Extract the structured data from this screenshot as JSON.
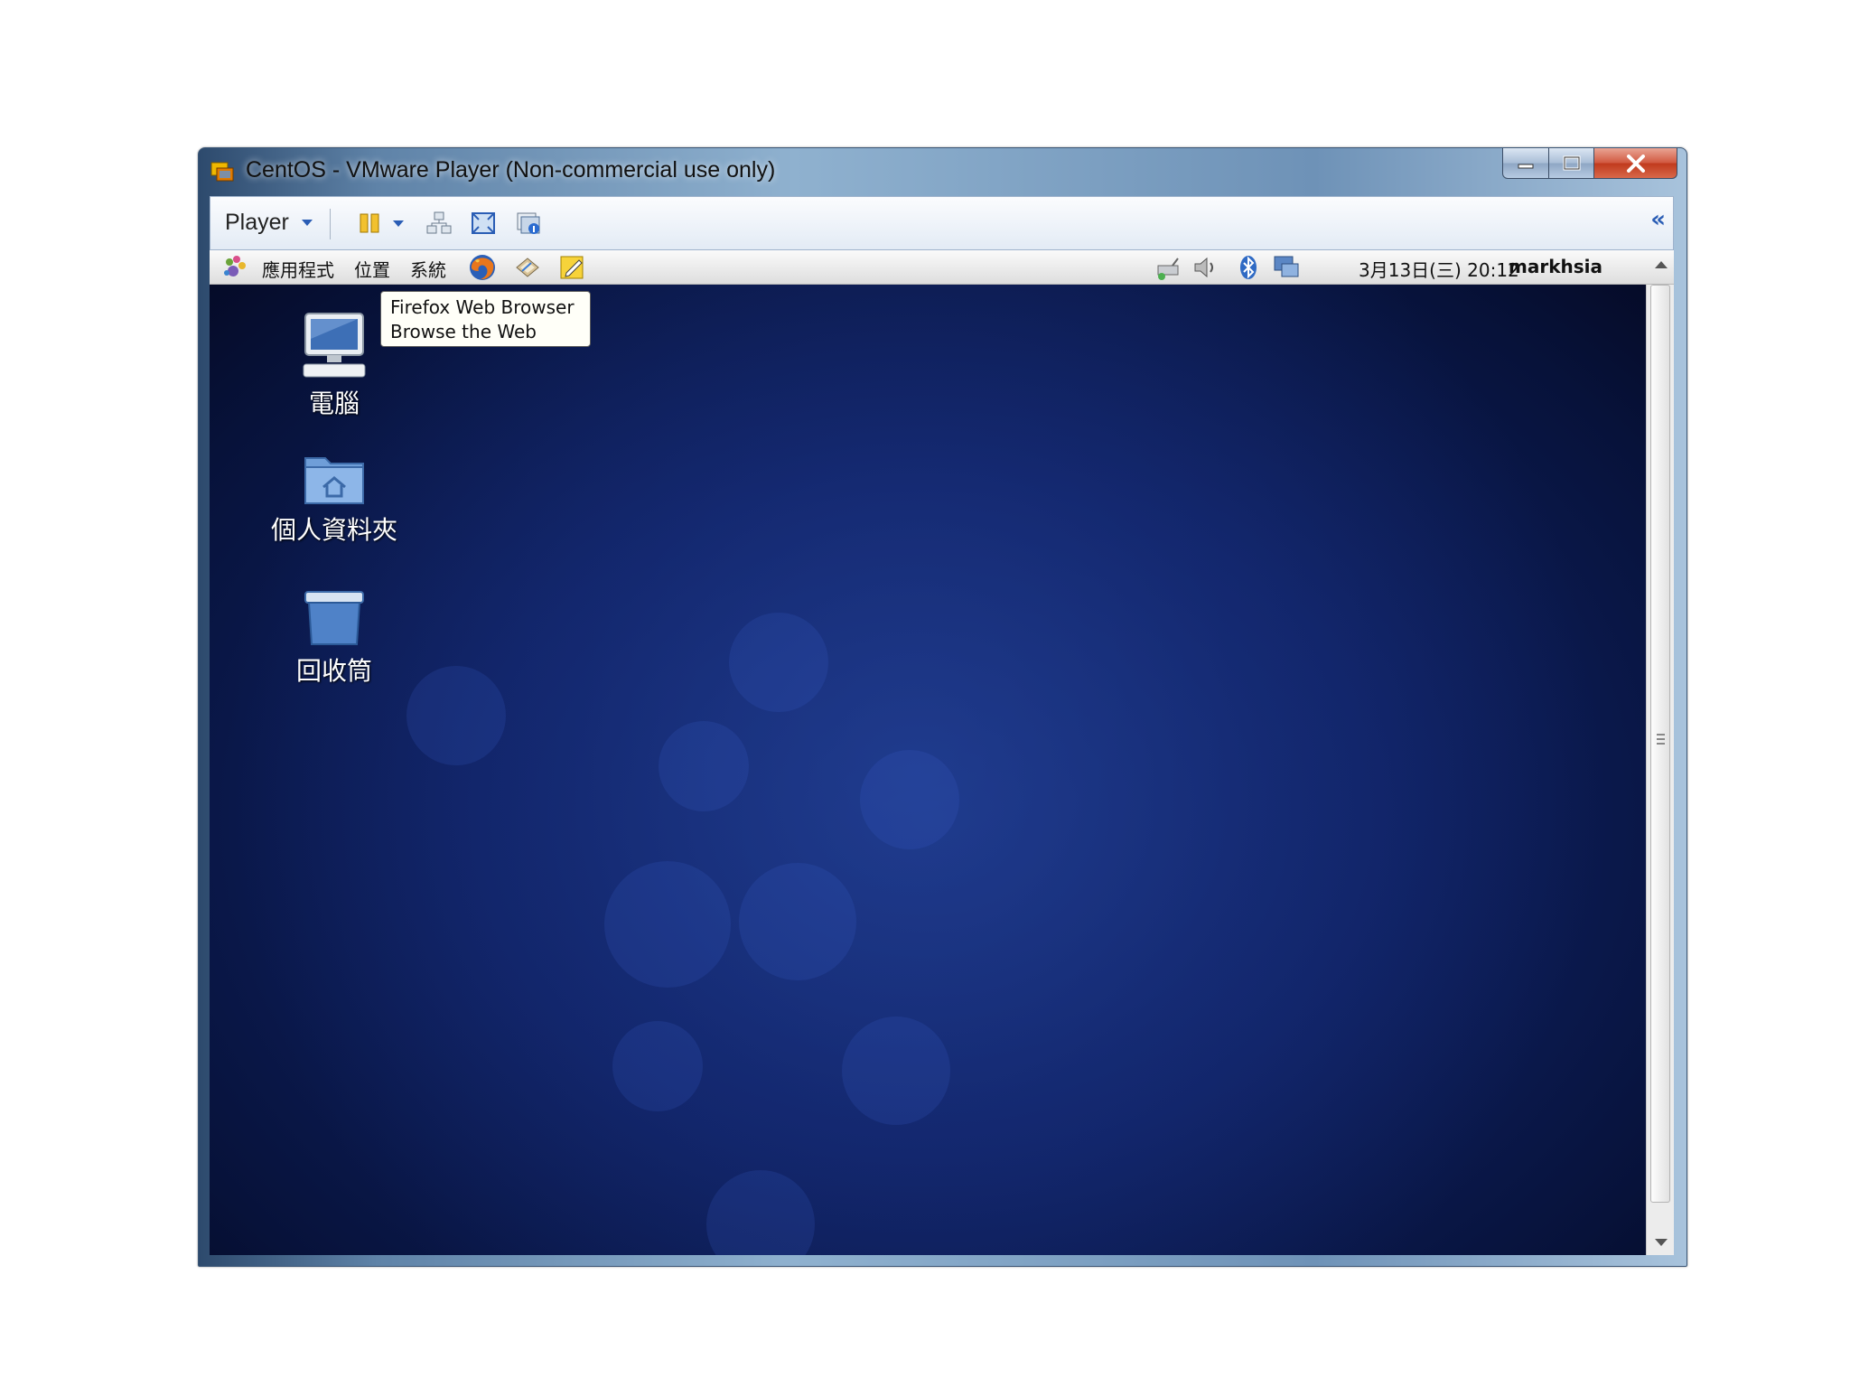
{
  "window": {
    "title": "CentOS - VMware Player (Non-commercial use only)"
  },
  "toolbar": {
    "player_label": "Player"
  },
  "panel": {
    "menus": [
      "應用程式",
      "位置",
      "系統"
    ],
    "datetime": "3月13日(三) 20:12",
    "username": "markhsia"
  },
  "tooltip": {
    "line1": "Firefox Web Browser",
    "line2": "Browse the Web"
  },
  "desktop_icons": [
    {
      "label": "電腦",
      "icon": "computer-icon"
    },
    {
      "label": "個人資料夾",
      "icon": "home-folder-icon"
    },
    {
      "label": "回收筒",
      "icon": "trash-icon"
    }
  ],
  "colors": {
    "desktop_background": "#0e2060",
    "panel_background": "#e8e8e8",
    "close_button": "#c0391c"
  }
}
